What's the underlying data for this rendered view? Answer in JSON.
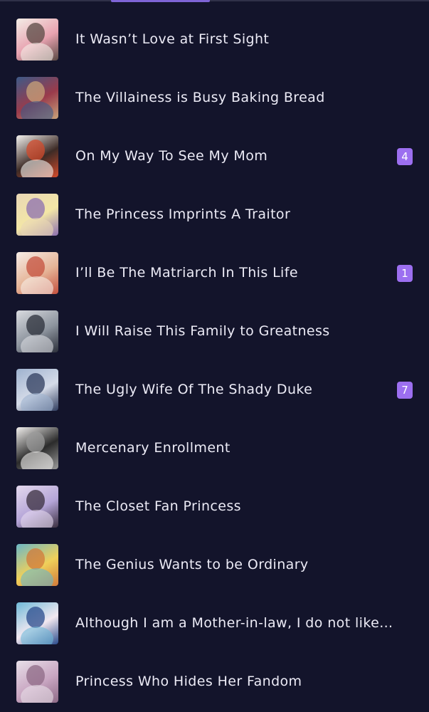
{
  "library": {
    "items": [
      {
        "title": "It Wasn’t Love at First Sight",
        "badge": "",
        "cover_colors": [
          "#f3ede6",
          "#5a4a44",
          "#e8a2b0"
        ]
      },
      {
        "title": "The Villainess is Busy Baking Bread",
        "badge": "",
        "cover_colors": [
          "#3d5a88",
          "#c8a37a",
          "#9a3b4b"
        ]
      },
      {
        "title": "On My Way To See My Mom",
        "badge": "4",
        "cover_colors": [
          "#f4f2ef",
          "#d24b2c",
          "#3d2b26"
        ]
      },
      {
        "title": "The Princess Imprints A Traitor",
        "badge": "",
        "cover_colors": [
          "#e9d7b6",
          "#8c6fb0",
          "#f3e6a6"
        ]
      },
      {
        "title": "I’ll Be The Matriarch In This Life",
        "badge": "1",
        "cover_colors": [
          "#f6ece6",
          "#c4503e",
          "#e5b497"
        ]
      },
      {
        "title": "I Will Raise This Family to Greatness",
        "badge": "",
        "cover_colors": [
          "#d9dbe0",
          "#2b2f3a",
          "#8d949e"
        ]
      },
      {
        "title": "The Ugly Wife Of The Shady Duke",
        "badge": "7",
        "cover_colors": [
          "#9eb2cf",
          "#2f3c5e",
          "#d5dbe8"
        ]
      },
      {
        "title": "Mercenary Enrollment",
        "badge": "",
        "cover_colors": [
          "#f2f0ee",
          "#9b9b9b",
          "#2b2b2b"
        ]
      },
      {
        "title": "The Closet Fan Princess",
        "badge": "",
        "cover_colors": [
          "#e4d9ee",
          "#3a2f3f",
          "#b5a5d8"
        ]
      },
      {
        "title": "The Genius Wants to be Ordinary",
        "badge": "",
        "cover_colors": [
          "#6bb7c6",
          "#d27a3a",
          "#f0d05a"
        ]
      },
      {
        "title": "Although I am a Mother-in-law, I do not like …",
        "badge": "",
        "cover_colors": [
          "#6fb9d8",
          "#2a4b8c",
          "#f2e8f0"
        ]
      },
      {
        "title": "Princess Who Hides Her Fandom",
        "badge": "",
        "cover_colors": [
          "#e7dfe8",
          "#8d6a86",
          "#c9a6c2"
        ]
      }
    ]
  }
}
